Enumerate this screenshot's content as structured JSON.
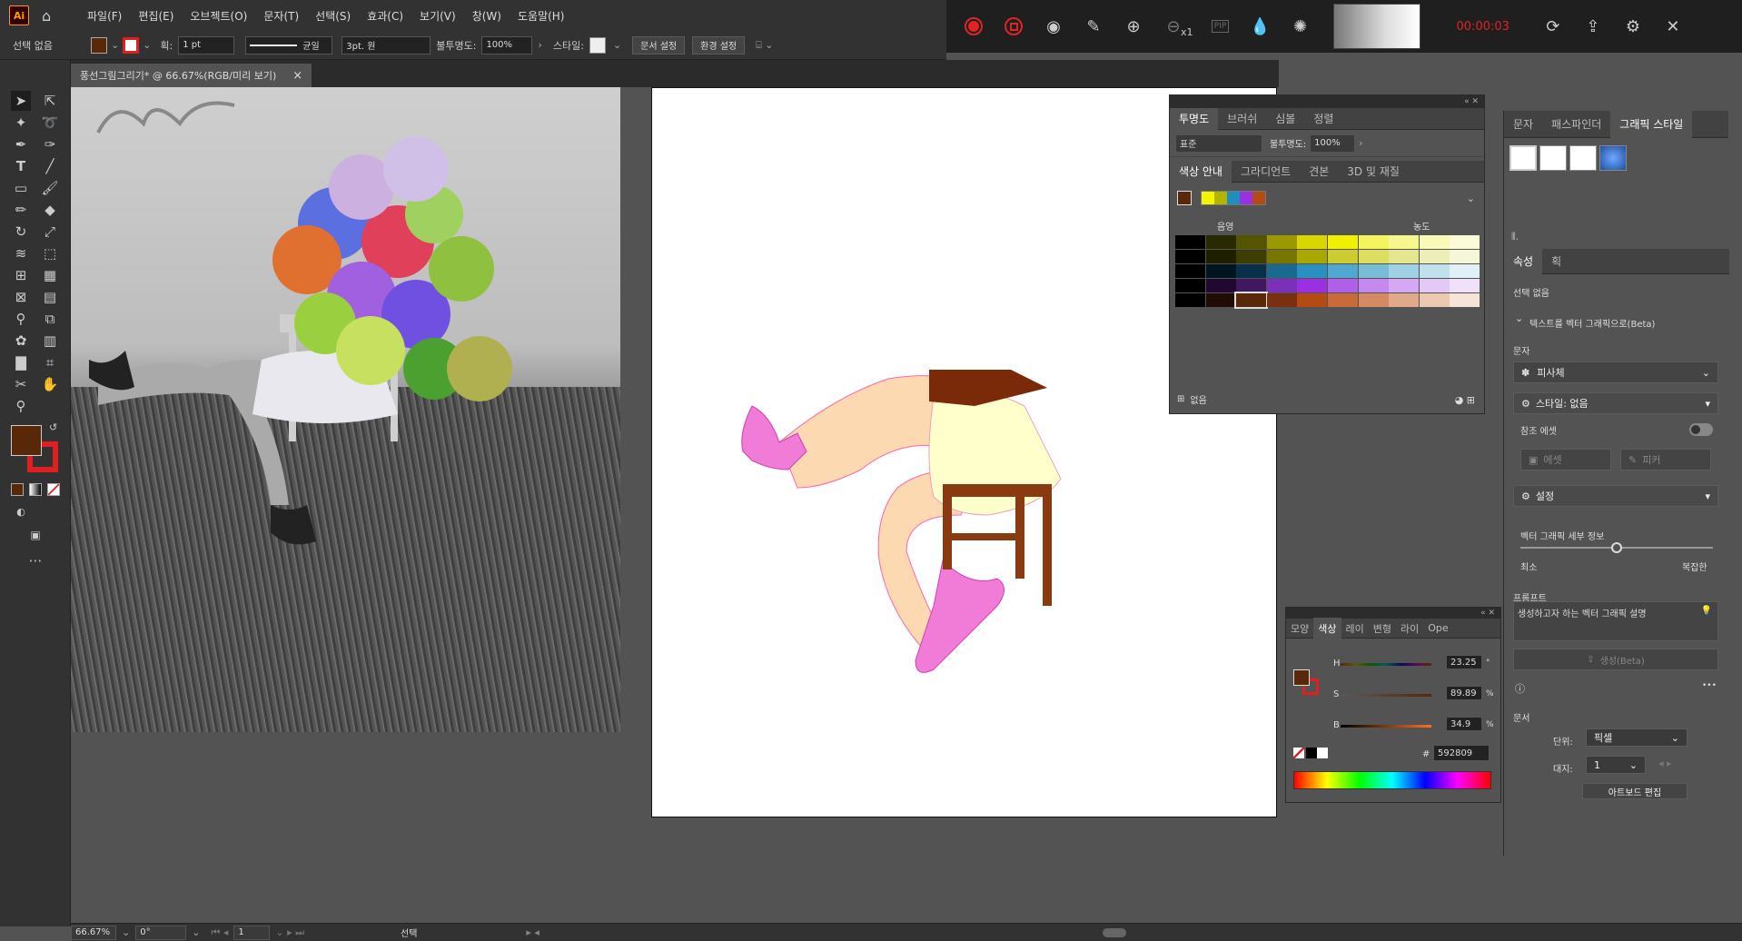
{
  "app": {
    "logo": "Ai",
    "home_icon": "home-icon"
  },
  "menu": [
    "파일(F)",
    "편집(E)",
    "오브젝트(O)",
    "문자(T)",
    "선택(S)",
    "효과(C)",
    "보기(V)",
    "창(W)",
    "도움말(H)"
  ],
  "recorder": {
    "timer": "00:00:03",
    "zoom_label": "x1",
    "pip_label": "PIP",
    "colors": {
      "record": "#e02424",
      "timer": "#e02424"
    }
  },
  "control": {
    "selection": "선택 없음",
    "stroke_label": "획:",
    "stroke_value": "1 pt",
    "stroke_style": "균일",
    "brush": "3pt. 원",
    "opacity_label": "불투명도:",
    "opacity_value": "100%",
    "style_label": "스타일:",
    "doc_setup": "문서 설정",
    "prefs": "환경 설정"
  },
  "doc_tab": {
    "title": "풍선그림그리기* @ 66.67%(RGB/미리 보기)",
    "close": "×"
  },
  "transparency_panel": {
    "tabs": [
      "투명도",
      "브러쉬",
      "심볼",
      "정렬"
    ],
    "blend_mode": "표준",
    "opacity_label": "불투명도:",
    "opacity_value": "100%",
    "guide_tabs": [
      "색상 안내",
      "그라디언트",
      "견본",
      "3D 및 재질"
    ],
    "shade_label": "음영",
    "tint_label": "농도",
    "footer_label": "없음",
    "harmony_colors": [
      "#f5f500",
      "#b5b500",
      "#1e90c0",
      "#9b30e0",
      "#b44a14"
    ]
  },
  "color_panel": {
    "tabs": [
      "모양",
      "색상",
      "레이",
      "변형",
      "라이",
      "Ope"
    ],
    "h_label": "H",
    "h_value": "23.25",
    "h_unit": "°",
    "s_label": "S",
    "s_value": "89.89",
    "s_unit": "%",
    "b_label": "B",
    "b_value": "34.9",
    "b_unit": "%",
    "hex_label": "#",
    "hex_value": "592809",
    "fill_color": "#592809",
    "stroke_color": "#e02020"
  },
  "right_panel": {
    "top_tabs": [
      "문자",
      "패스파인더",
      "그래픽 스타일"
    ],
    "prop_tabs": [
      "속성",
      "획"
    ],
    "selection": "선택 없음",
    "section_title": "텍스트를 벡터 그래픽으로(Beta)",
    "subject_label": "문자",
    "subject_value": "피사체",
    "style_value": "스타일: 없음",
    "reference_label": "참조 에셋",
    "asset_button": "에셋",
    "picker_button": "피커",
    "settings_label": "설정",
    "detail_label": "벡터 그래픽 세부 정보",
    "min_label": "최소",
    "max_label": "복잡한",
    "prompt_label": "프롬프트",
    "prompt_placeholder": "생성하고자 하는 벡터 그래픽 설명",
    "generate_button": "생성(Beta)",
    "more": "•••",
    "document_label": "문서",
    "unit_label": "단위:",
    "unit_value": "픽셀",
    "artboard_label": "대지:",
    "artboard_value": "1",
    "artboard_edit": "아트보드 편집"
  },
  "status": {
    "zoom": "66.67%",
    "rotate": "0°",
    "page": "1",
    "tool": "선택"
  }
}
